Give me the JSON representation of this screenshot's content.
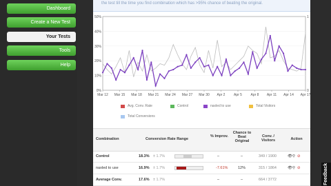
{
  "nav": {
    "items": [
      {
        "label": "Dashboard",
        "active": false
      },
      {
        "label": "Create a New Test",
        "active": false
      },
      {
        "label": "Your Tests",
        "active": true
      },
      {
        "label": "Tools",
        "active": false
      },
      {
        "label": "Help",
        "active": false
      }
    ]
  },
  "banner_text": "the test till the time you find combination which has >95% chance of beating the original.",
  "chart_data": {
    "type": "line",
    "categories": [
      "Mar 12",
      "Mar 15",
      "Mar 18",
      "Mar 21",
      "Mar 24",
      "Mar 27",
      "Mar 30",
      "Apr 2",
      "Apr 5",
      "Apr 8",
      "Apr 11",
      "Apr 14",
      "Apr 17"
    ],
    "ylim": [
      0,
      50
    ],
    "y_ticks": [
      "0%",
      "10%",
      "20%",
      "30%",
      "40%",
      "50%"
    ],
    "right_ticks": [
      "0",
      "1"
    ],
    "series": [
      {
        "name": "Control",
        "color": "#bdbdbd",
        "values": [
          18,
          14,
          11,
          16,
          22,
          12,
          27,
          9,
          19,
          13,
          24,
          13,
          15,
          18,
          17,
          22,
          31,
          24,
          18,
          14,
          23,
          29,
          17,
          12,
          27,
          15,
          34,
          16,
          19,
          14,
          17,
          20,
          23,
          30,
          27,
          25,
          18,
          43,
          22,
          23,
          27,
          20,
          15,
          14,
          13,
          15,
          39
        ]
      },
      {
        "name": "naxled to use",
        "color": "#7b3fbf",
        "values": [
          12,
          18,
          15,
          7,
          14,
          12,
          17,
          22,
          14,
          27,
          7,
          19,
          3,
          11,
          8,
          13,
          14,
          16,
          17,
          24,
          15,
          19,
          22,
          16,
          17,
          10,
          16,
          10,
          21,
          10,
          13,
          15,
          19,
          11,
          26,
          15,
          21,
          25,
          37,
          20,
          30,
          25,
          13,
          17,
          15,
          14,
          14
        ]
      }
    ],
    "legend": [
      {
        "label": "Avg. Conv. Rate",
        "color": "#d24b4b"
      },
      {
        "label": "Control",
        "color": "#5cb85c"
      },
      {
        "label": "naxled to use",
        "color": "#8b45c8"
      },
      {
        "label": "Total Visitors",
        "color": "#f0c040"
      },
      {
        "label": "Total Conversions",
        "color": "#a8c8f0"
      }
    ]
  },
  "table": {
    "headers": [
      "Combination",
      "Conversion Rate Range",
      "% Improv.",
      "Chance to Beat Original",
      "Conv. / Visitors",
      "Action"
    ],
    "rows": [
      {
        "name": "Control",
        "rate": "18.3%",
        "pm": "± 1.7%",
        "improv": "–",
        "chance": "–",
        "cv": "349 / 1900"
      },
      {
        "name": "naxled to use",
        "rate": "16.9%",
        "pm": "± 1.7%",
        "improv": "-7.61%",
        "chance": "12%",
        "cv": "315 / 1864"
      },
      {
        "name": "Average Conv.",
        "rate": "17.6%",
        "pm": "± 1.7%",
        "improv": "–",
        "chance": "–",
        "cv": "664 / 3772"
      }
    ]
  },
  "feedback_label": "Feedback"
}
